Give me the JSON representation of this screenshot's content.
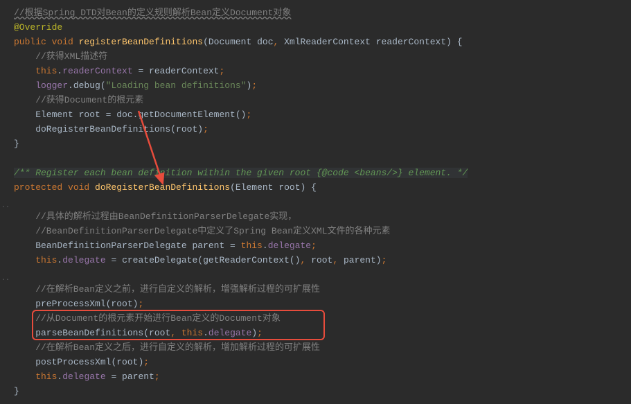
{
  "code": {
    "l1_comment": "//根据Spring DTD对Bean的定义规则解析Bean定义Document对象",
    "l2_annotation": "@Override",
    "l3_public": "public ",
    "l3_void": "void ",
    "l3_method": "registerBeanDefinitions",
    "l3_paren_open": "(",
    "l3_p1_type": "Document ",
    "l3_p1_name": "doc",
    "l3_comma1": ", ",
    "l3_p2_type": "XmlReaderContext ",
    "l3_p2_name": "readerContext",
    "l3_paren_close": ") {",
    "l4_comment": "    //获得XML描述符",
    "l5_this": "    this",
    "l5_dot": ".",
    "l5_field": "readerContext",
    "l5_eq": " = readerContext",
    "l5_semi": ";",
    "l6_logger": "    logger",
    "l6_dot": ".",
    "l6_debug": "debug",
    "l6_po": "(",
    "l6_str": "\"Loading bean definitions\"",
    "l6_pc": ")",
    "l6_semi": ";",
    "l7_comment": "    //获得Document的根元素",
    "l8_pre": "    Element root = doc.",
    "l8_call": "getDocumentElement",
    "l8_po": "()",
    "l8_semi": ";",
    "l9_call": "    doRegisterBeanDefinitions",
    "l9_args": "(root)",
    "l9_semi": ";",
    "l10_brace": "}",
    "l12_doc_a": "/** Register each bean definition within the given root ",
    "l12_doc_b": "{@code <beans/>}",
    "l12_doc_c": " element. */",
    "l13_protected": "protected ",
    "l13_void": "void ",
    "l13_method": "doRegisterBeanDefinitions",
    "l13_sig": "(Element root) {",
    "l15_comment": "    //具体的解析过程由BeanDefinitionParserDelegate实现，",
    "l16_comment": "    //BeanDefinitionParserDelegate中定义了Spring Bean定义XML文件的各种元素",
    "l17_pre": "    BeanDefinitionParserDelegate parent = ",
    "l17_this": "this",
    "l17_dot": ".",
    "l17_field": "delegate",
    "l17_semi": ";",
    "l18_this": "    this",
    "l18_dot": ".",
    "l18_field": "delegate",
    "l18_eq": " = ",
    "l18_call": "createDelegate",
    "l18_po": "(",
    "l18_call2": "getReaderContext",
    "l18_po2": "()",
    "l18_comma": ", ",
    "l18_root": "root",
    "l18_comma2": ", ",
    "l18_parent": "parent)",
    "l18_semi": ";",
    "l20_comment": "    //在解析Bean定义之前，进行自定义的解析，增强解析过程的可扩展性",
    "l21_call": "    preProcessXml",
    "l21_args": "(root)",
    "l21_semi": ";",
    "l22_comment": "    //从Document的根元素开始进行Bean定义的Document对象",
    "l23_call": "    parseBeanDefinitions",
    "l23_po": "(root",
    "l23_comma": ", ",
    "l23_this": "this",
    "l23_dot": ".",
    "l23_field": "delegate",
    "l23_pc": ")",
    "l23_semi": ";",
    "l24_comment": "    //在解析Bean定义之后，进行自定义的解析，增加解析过程的可扩展性",
    "l25_call": "    postProcessXml",
    "l25_args": "(root)",
    "l25_semi": ";",
    "l26_this": "    this",
    "l26_dot": ".",
    "l26_field": "delegate",
    "l26_eq": " = parent",
    "l26_semi": ";",
    "l27_brace": "}"
  },
  "gutter": {
    "dots1": "..",
    "dots2": ".."
  }
}
